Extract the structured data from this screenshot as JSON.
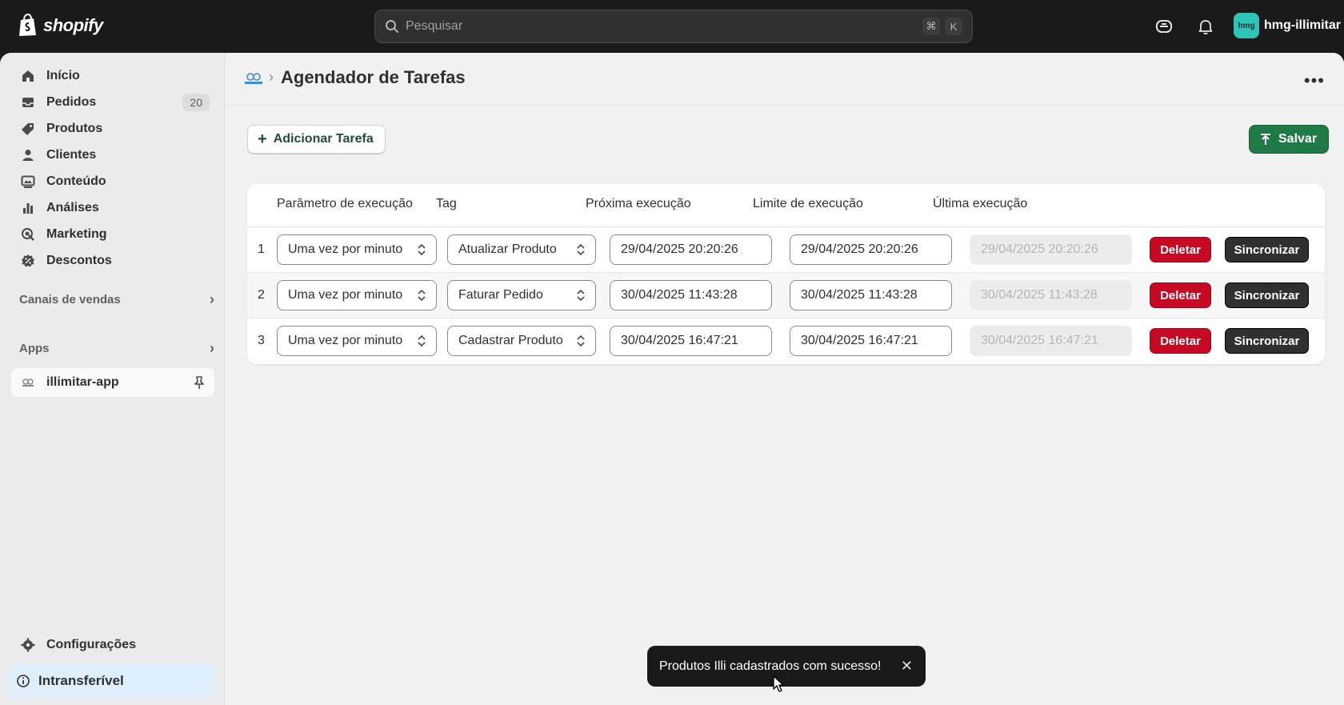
{
  "topbar": {
    "logo_text": "shopify",
    "search_placeholder": "Pesquisar",
    "shortcut_keys": [
      "⌘",
      "K"
    ],
    "store_avatar": "hmg",
    "store_name": "hmg-illimitar"
  },
  "sidebar": {
    "items": [
      {
        "label": "Início",
        "icon": "home-icon"
      },
      {
        "label": "Pedidos",
        "icon": "inbox-icon",
        "badge": "20"
      },
      {
        "label": "Produtos",
        "icon": "tag-icon"
      },
      {
        "label": "Clientes",
        "icon": "person-icon"
      },
      {
        "label": "Conteúdo",
        "icon": "content-icon"
      },
      {
        "label": "Análises",
        "icon": "bar-chart-icon"
      },
      {
        "label": "Marketing",
        "icon": "target-icon"
      },
      {
        "label": "Descontos",
        "icon": "discount-icon"
      }
    ],
    "sales_channels_label": "Canais de vendas",
    "apps_label": "Apps",
    "app_name": "illimitar-app",
    "settings_label": "Configurações",
    "intransferivel_label": "Intransferível"
  },
  "page": {
    "title": "Agendador de Tarefas",
    "add_button": "Adicionar Tarefa",
    "save_button": "Salvar"
  },
  "table": {
    "headers": [
      "Parâmetro de execução",
      "Tag",
      "Próxima execução",
      "Limite de execução",
      "Última execução"
    ],
    "rows": [
      {
        "num": "1",
        "param": "Uma vez por minuto",
        "tag": "Atualizar Produto",
        "next": "29/04/2025 20:20:26",
        "limit": "29/04/2025 20:20:26",
        "last": "29/04/2025 20:20:26"
      },
      {
        "num": "2",
        "param": "Uma vez por minuto",
        "tag": "Faturar Pedido",
        "next": "30/04/2025 11:43:28",
        "limit": "30/04/2025 11:43:28",
        "last": "30/04/2025 11:43:28"
      },
      {
        "num": "3",
        "param": "Uma vez por minuto",
        "tag": "Cadastrar Produto",
        "next": "30/04/2025 16:47:21",
        "limit": "30/04/2025 16:47:21",
        "last": "30/04/2025 16:47:21"
      }
    ],
    "delete_label": "Deletar",
    "sync_label": "Sincronizar"
  },
  "toast": {
    "message": "Produtos Illi cadastrados com sucesso!"
  },
  "colors": {
    "topbar": "#1a1a1a",
    "save_green": "#1f7a47",
    "delete_red": "#c70a24",
    "sync_dark": "#303030",
    "avatar_teal": "#2ec4b6"
  }
}
